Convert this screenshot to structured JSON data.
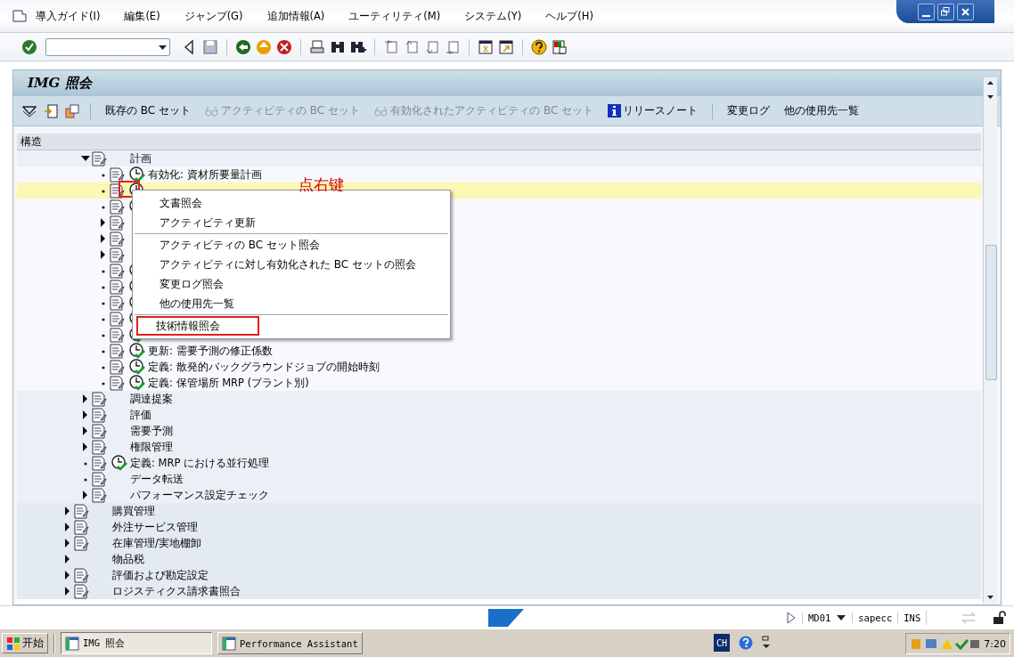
{
  "menu_bar": [
    "導入ガイド(I)",
    "編集(E)",
    "ジャンプ(G)",
    "追加情報(A)",
    "ユーティリティ(M)",
    "システム(Y)",
    "ヘルプ(H)"
  ],
  "title": "IMG 照会",
  "app_toolbar": [
    {
      "label": "既存の BC セット",
      "kind": "text",
      "disabled": false,
      "divider_before": true
    },
    {
      "label": "アクティビティの BC セット",
      "kind": "glasses",
      "disabled": true,
      "divider_before": false
    },
    {
      "label": "有効化されたアクティビティの BC セット",
      "kind": "glasses",
      "disabled": true,
      "divider_before": false
    },
    {
      "label": "リリースノート",
      "kind": "info",
      "disabled": false,
      "divider_before": false
    },
    {
      "label": "変更ログ",
      "kind": "text",
      "disabled": false,
      "divider_before": true
    },
    {
      "label": "他の使用先一覧",
      "kind": "text",
      "disabled": false,
      "divider_before": false
    }
  ],
  "tree_header": "構造",
  "tree": {
    "branch": [
      {
        "label": "計画",
        "kind": "folder",
        "expanded": true,
        "doc": true,
        "clock": false,
        "selected": false,
        "children": [
          {
            "label": "有効化: 資材所要量計画",
            "kind": "leaf",
            "doc": true,
            "clock": true,
            "selected": false
          },
          {
            "kind": "leaf",
            "doc": true,
            "clock": true,
            "selected": true
          },
          {
            "kind": "leaf",
            "doc": true,
            "clock": true,
            "selected": false
          },
          {
            "kind": "folder",
            "expanded": false,
            "doc": true,
            "clock": false,
            "selected": false
          },
          {
            "kind": "folder",
            "expanded": false,
            "doc": true,
            "clock": false,
            "selected": false
          },
          {
            "kind": "folder",
            "expanded": false,
            "doc": true,
            "clock": false,
            "selected": false
          },
          {
            "kind": "leaf",
            "doc": true,
            "clock": true,
            "selected": false
          },
          {
            "kind": "leaf",
            "doc": true,
            "clock": true,
            "selected": false
          },
          {
            "kind": "leaf",
            "doc": true,
            "clock": true,
            "selected": false
          },
          {
            "kind": "leaf",
            "doc": true,
            "clock": true,
            "selected": false
          },
          {
            "kind": "leaf",
            "doc": true,
            "clock": true,
            "selected": false
          },
          {
            "label": "更新: 需要予測の修正係数",
            "kind": "leaf",
            "doc": true,
            "clock": true,
            "selected": false
          },
          {
            "label": "定義: 散発的バックグラウンドジョブの開始時刻",
            "kind": "leaf",
            "doc": true,
            "clock": true,
            "selected": false
          },
          {
            "label": "定義: 保管場所 MRP (プラント別)",
            "kind": "leaf",
            "doc": true,
            "clock": true,
            "selected": false
          }
        ]
      },
      {
        "label": "調達提案",
        "kind": "folder",
        "expanded": false,
        "doc": true,
        "clock": false,
        "selected": false
      },
      {
        "label": "評価",
        "kind": "folder",
        "expanded": false,
        "doc": true,
        "clock": false,
        "selected": false
      },
      {
        "label": "需要予測",
        "kind": "folder",
        "expanded": false,
        "doc": true,
        "clock": false,
        "selected": false
      },
      {
        "label": "権限管理",
        "kind": "folder",
        "expanded": false,
        "doc": true,
        "clock": false,
        "selected": false
      },
      {
        "label": "定義: MRP における並行処理",
        "kind": "leaf",
        "doc": true,
        "clock": true,
        "selected": false
      },
      {
        "label": "データ転送",
        "kind": "leaf",
        "doc": true,
        "clock": false,
        "selected": false
      },
      {
        "label": "パフォーマンス設定チェック",
        "kind": "folder",
        "expanded": false,
        "doc": true,
        "clock": false,
        "selected": false
      }
    ],
    "nodes": [
      {
        "label": "購買管理",
        "kind": "folder",
        "expanded": false,
        "doc": true,
        "clock": false,
        "selected": false
      },
      {
        "label": "外注サービス管理",
        "kind": "folder",
        "expanded": false,
        "doc": true,
        "clock": false,
        "selected": false
      },
      {
        "label": "在庫管理/実地棚卸",
        "kind": "folder",
        "expanded": false,
        "doc": true,
        "clock": false,
        "selected": false
      },
      {
        "label": "物品税",
        "kind": "folder",
        "expanded": false,
        "doc": false,
        "clock": false,
        "selected": false
      },
      {
        "label": "評価および勘定設定",
        "kind": "folder",
        "expanded": false,
        "doc": true,
        "clock": false,
        "selected": false
      },
      {
        "label": "ロジスティクス請求書照合",
        "kind": "folder",
        "expanded": false,
        "doc": true,
        "clock": false,
        "selected": false
      }
    ]
  },
  "context_menu": [
    {
      "label": "文書照会",
      "divider_before": false,
      "highlighted": false
    },
    {
      "label": "アクティビティ更新",
      "divider_before": false,
      "highlighted": false
    },
    {
      "label": "アクティビティの BC セット照会",
      "divider_before": true,
      "highlighted": false
    },
    {
      "label": "アクティビティに対し有効化された BC セットの照会",
      "divider_before": false,
      "highlighted": false
    },
    {
      "label": "変更ログ照会",
      "divider_before": false,
      "highlighted": false
    },
    {
      "label": "他の使用先一覧",
      "divider_before": false,
      "highlighted": false
    },
    {
      "label": "技術情報照会",
      "divider_before": true,
      "highlighted": true
    }
  ],
  "annotation": "点右键",
  "status_bar": {
    "system": "MD01",
    "host": "sapecc",
    "mode": "INS"
  },
  "taskbar": {
    "start": "开始",
    "tasks": [
      {
        "label": "IMG 照会",
        "selected": true
      },
      {
        "label": "Performance Assistant",
        "selected": false
      }
    ],
    "language": "CH",
    "time": "7:20"
  }
}
